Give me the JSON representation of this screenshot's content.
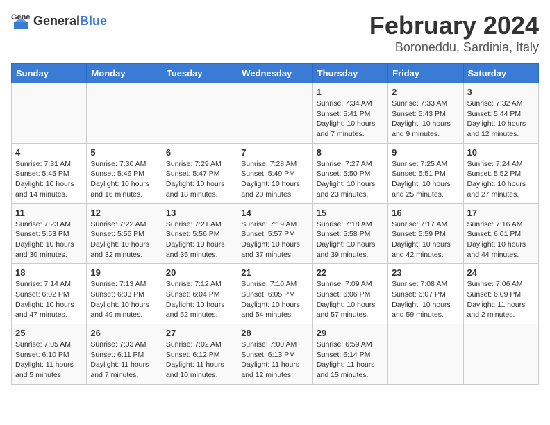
{
  "logo": {
    "general": "General",
    "blue": "Blue"
  },
  "title": "February 2024",
  "subtitle": "Boroneddu, Sardinia, Italy",
  "days_of_week": [
    "Sunday",
    "Monday",
    "Tuesday",
    "Wednesday",
    "Thursday",
    "Friday",
    "Saturday"
  ],
  "weeks": [
    [
      {
        "day": "",
        "info": ""
      },
      {
        "day": "",
        "info": ""
      },
      {
        "day": "",
        "info": ""
      },
      {
        "day": "",
        "info": ""
      },
      {
        "day": "1",
        "info": "Sunrise: 7:34 AM\nSunset: 5:41 PM\nDaylight: 10 hours and 7 minutes."
      },
      {
        "day": "2",
        "info": "Sunrise: 7:33 AM\nSunset: 5:43 PM\nDaylight: 10 hours and 9 minutes."
      },
      {
        "day": "3",
        "info": "Sunrise: 7:32 AM\nSunset: 5:44 PM\nDaylight: 10 hours and 12 minutes."
      }
    ],
    [
      {
        "day": "4",
        "info": "Sunrise: 7:31 AM\nSunset: 5:45 PM\nDaylight: 10 hours and 14 minutes."
      },
      {
        "day": "5",
        "info": "Sunrise: 7:30 AM\nSunset: 5:46 PM\nDaylight: 10 hours and 16 minutes."
      },
      {
        "day": "6",
        "info": "Sunrise: 7:29 AM\nSunset: 5:47 PM\nDaylight: 10 hours and 18 minutes."
      },
      {
        "day": "7",
        "info": "Sunrise: 7:28 AM\nSunset: 5:49 PM\nDaylight: 10 hours and 20 minutes."
      },
      {
        "day": "8",
        "info": "Sunrise: 7:27 AM\nSunset: 5:50 PM\nDaylight: 10 hours and 23 minutes."
      },
      {
        "day": "9",
        "info": "Sunrise: 7:25 AM\nSunset: 5:51 PM\nDaylight: 10 hours and 25 minutes."
      },
      {
        "day": "10",
        "info": "Sunrise: 7:24 AM\nSunset: 5:52 PM\nDaylight: 10 hours and 27 minutes."
      }
    ],
    [
      {
        "day": "11",
        "info": "Sunrise: 7:23 AM\nSunset: 5:53 PM\nDaylight: 10 hours and 30 minutes."
      },
      {
        "day": "12",
        "info": "Sunrise: 7:22 AM\nSunset: 5:55 PM\nDaylight: 10 hours and 32 minutes."
      },
      {
        "day": "13",
        "info": "Sunrise: 7:21 AM\nSunset: 5:56 PM\nDaylight: 10 hours and 35 minutes."
      },
      {
        "day": "14",
        "info": "Sunrise: 7:19 AM\nSunset: 5:57 PM\nDaylight: 10 hours and 37 minutes."
      },
      {
        "day": "15",
        "info": "Sunrise: 7:18 AM\nSunset: 5:58 PM\nDaylight: 10 hours and 39 minutes."
      },
      {
        "day": "16",
        "info": "Sunrise: 7:17 AM\nSunset: 5:59 PM\nDaylight: 10 hours and 42 minutes."
      },
      {
        "day": "17",
        "info": "Sunrise: 7:16 AM\nSunset: 6:01 PM\nDaylight: 10 hours and 44 minutes."
      }
    ],
    [
      {
        "day": "18",
        "info": "Sunrise: 7:14 AM\nSunset: 6:02 PM\nDaylight: 10 hours and 47 minutes."
      },
      {
        "day": "19",
        "info": "Sunrise: 7:13 AM\nSunset: 6:03 PM\nDaylight: 10 hours and 49 minutes."
      },
      {
        "day": "20",
        "info": "Sunrise: 7:12 AM\nSunset: 6:04 PM\nDaylight: 10 hours and 52 minutes."
      },
      {
        "day": "21",
        "info": "Sunrise: 7:10 AM\nSunset: 6:05 PM\nDaylight: 10 hours and 54 minutes."
      },
      {
        "day": "22",
        "info": "Sunrise: 7:09 AM\nSunset: 6:06 PM\nDaylight: 10 hours and 57 minutes."
      },
      {
        "day": "23",
        "info": "Sunrise: 7:08 AM\nSunset: 6:07 PM\nDaylight: 10 hours and 59 minutes."
      },
      {
        "day": "24",
        "info": "Sunrise: 7:06 AM\nSunset: 6:09 PM\nDaylight: 11 hours and 2 minutes."
      }
    ],
    [
      {
        "day": "25",
        "info": "Sunrise: 7:05 AM\nSunset: 6:10 PM\nDaylight: 11 hours and 5 minutes."
      },
      {
        "day": "26",
        "info": "Sunrise: 7:03 AM\nSunset: 6:11 PM\nDaylight: 11 hours and 7 minutes."
      },
      {
        "day": "27",
        "info": "Sunrise: 7:02 AM\nSunset: 6:12 PM\nDaylight: 11 hours and 10 minutes."
      },
      {
        "day": "28",
        "info": "Sunrise: 7:00 AM\nSunset: 6:13 PM\nDaylight: 11 hours and 12 minutes."
      },
      {
        "day": "29",
        "info": "Sunrise: 6:59 AM\nSunset: 6:14 PM\nDaylight: 11 hours and 15 minutes."
      },
      {
        "day": "",
        "info": ""
      },
      {
        "day": "",
        "info": ""
      }
    ]
  ]
}
